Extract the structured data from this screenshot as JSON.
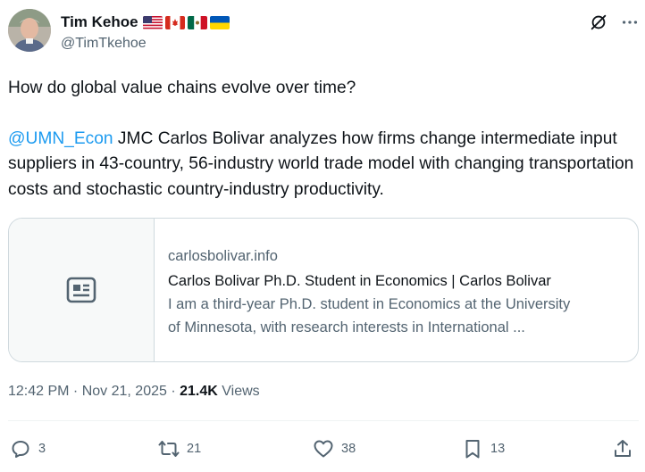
{
  "author": {
    "display_name": "Tim Kehoe",
    "handle": "@TimTkehoe",
    "flags": [
      "us-flag",
      "canada-flag",
      "mexico-flag",
      "ukraine-flag"
    ]
  },
  "tweet": {
    "question": "How do global value chains evolve over time?",
    "mention": "@UMN_Econ",
    "body": " JMC Carlos Bolivar analyzes how firms change intermediate input suppliers in 43-country, 56-industry world trade model with changing transportation costs and stochastic country-industry productivity."
  },
  "card": {
    "domain": "carlosbolivar.info",
    "title": "Carlos Bolivar Ph.D. Student in Economics | Carlos Bolivar",
    "description_line1": "I am a third-year Ph.D. student in Economics at the University",
    "description_line2": "of Minnesota, with research interests in International ..."
  },
  "meta": {
    "time": "12:42 PM",
    "separator": " · ",
    "date": "Nov 21, 2025",
    "views_count": "21.4K",
    "views_label": " Views"
  },
  "actions": {
    "replies": "3",
    "reposts": "21",
    "likes": "38",
    "bookmarks": "13"
  },
  "colors": {
    "accent": "#1d9bf0",
    "text": "#0f1419",
    "secondary": "#536471",
    "border": "#cfd9de"
  }
}
